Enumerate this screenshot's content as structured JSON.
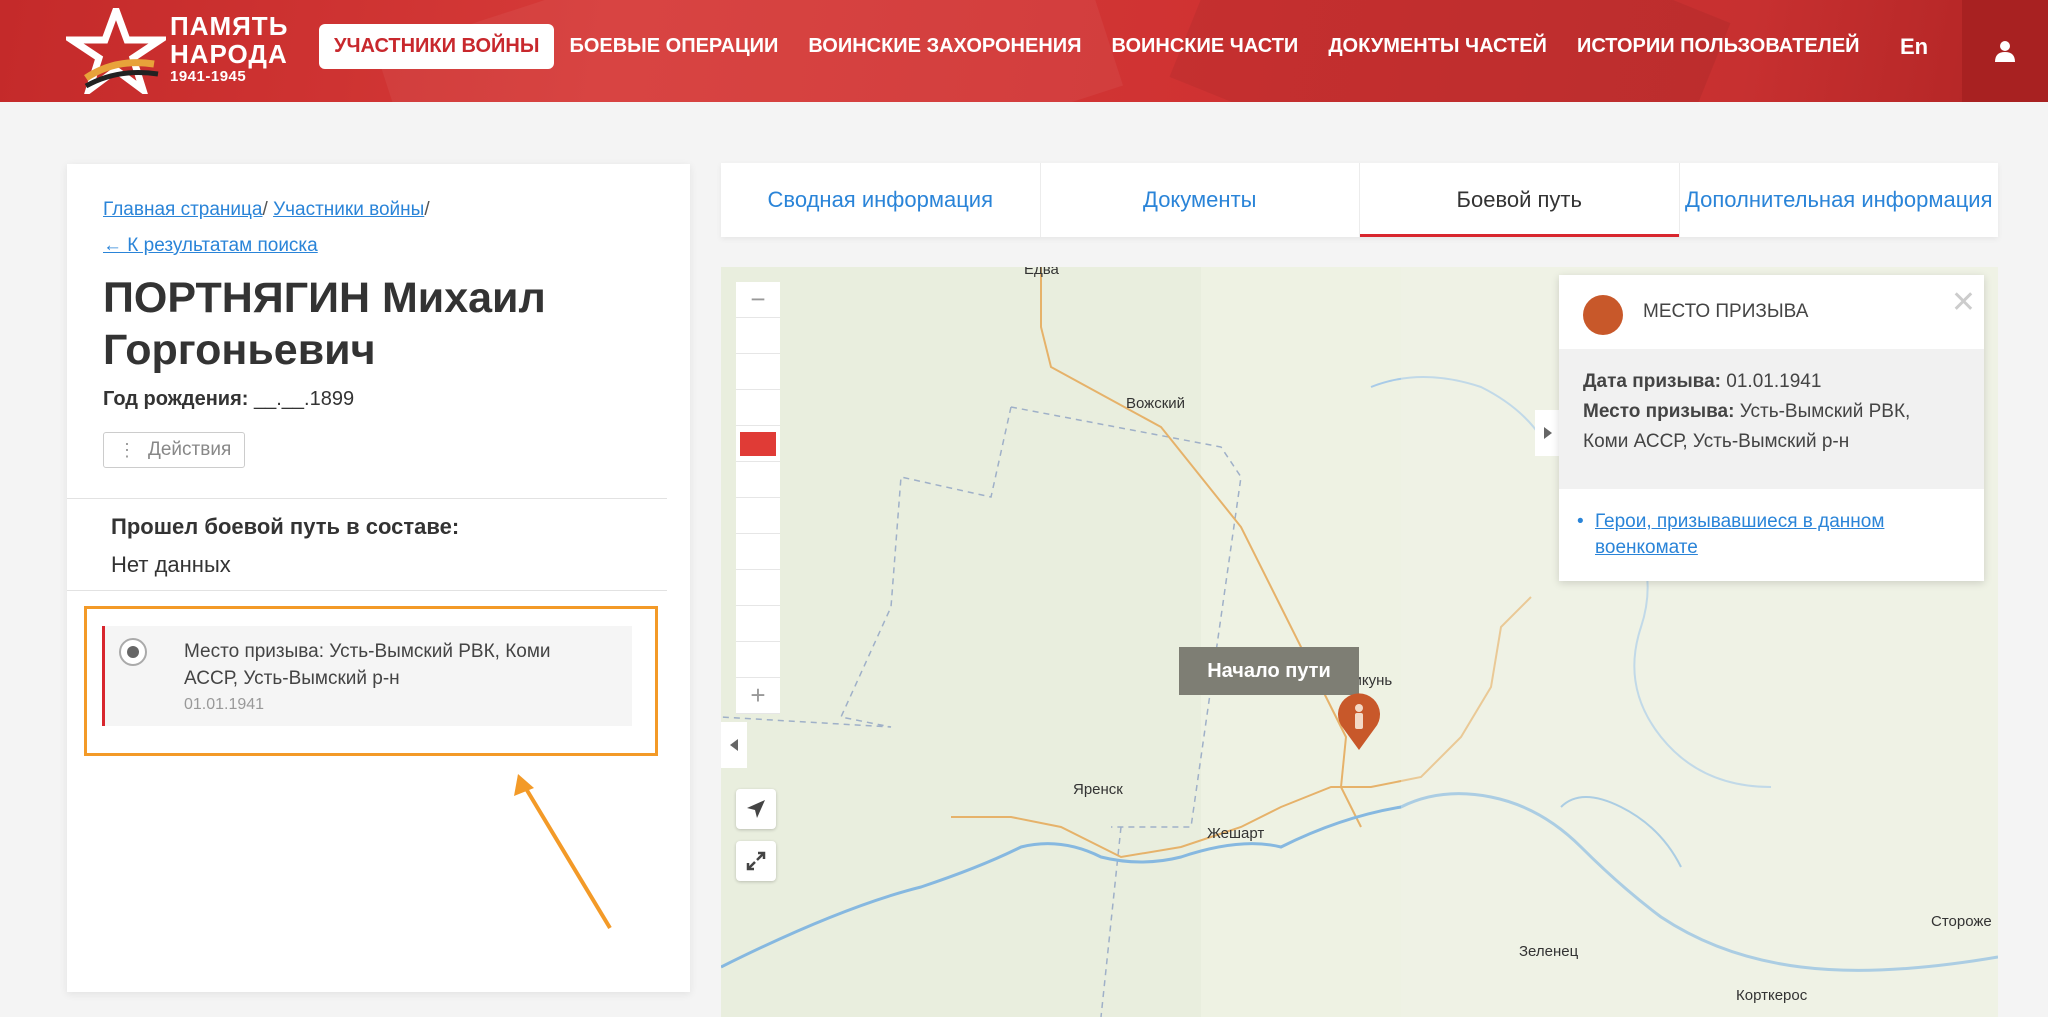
{
  "header": {
    "logo_line1": "ПАМЯТЬ",
    "logo_line2": "НАРОДА",
    "logo_years": "1941-1945",
    "nav": [
      {
        "label": "УЧАСТНИКИ ВОЙНЫ",
        "active": true
      },
      {
        "label": "БОЕВЫЕ ОПЕРАЦИИ"
      },
      {
        "label": "ВОИНСКИЕ ЗАХОРОНЕНИЯ"
      },
      {
        "label": "ВОИНСКИЕ ЧАСТИ"
      },
      {
        "label": "ДОКУМЕНТЫ ЧАСТЕЙ"
      },
      {
        "label": "ИСТОРИИ ПОЛЬЗОВАТЕЛЕЙ"
      }
    ],
    "lang": "En",
    "user_icon": "user-icon"
  },
  "left": {
    "breadcrumbs": {
      "home": "Главная страница",
      "participants": "Участники войны",
      "back": "← К результатам поиска"
    },
    "name": "ПОРТНЯГИН Михаил Горгоньевич",
    "birth_label": "Год рождения:",
    "birth_value": "__.__.1899",
    "actions_label": "Действия",
    "path_title": "Прошел боевой путь в составе:",
    "path_value": "Нет данных",
    "event": {
      "text": "Место призыва: Усть-Вымский РВК, Коми АССР, Усть-Вымский р-н",
      "date": "01.01.1941"
    }
  },
  "tabs": [
    {
      "label": "Сводная информация"
    },
    {
      "label": "Документы"
    },
    {
      "label": "Боевой путь",
      "active": true
    },
    {
      "label": "Дополнительная информация"
    }
  ],
  "map": {
    "towns": [
      "Едва",
      "Вожский",
      "Микунь",
      "Яренск",
      "Жешарт",
      "Зеленец",
      "Корткерос",
      "Стороже"
    ],
    "start_label": "Начало пути",
    "popup": {
      "title": "МЕСТО ПРИЗЫВА",
      "date_label": "Дата призыва:",
      "date_value": "01.01.1941",
      "place_label": "Место призыва:",
      "place_value": "Усть-Вымский РВК, Коми АССР, Усть-Вымский р-н",
      "link": "Герои, призывавшиеся в данном военкомате"
    }
  },
  "colors": {
    "brand_red": "#c8282d",
    "link_blue": "#2a84d8",
    "highlight_orange": "#f39a28",
    "pin_orange": "#c8582a"
  }
}
